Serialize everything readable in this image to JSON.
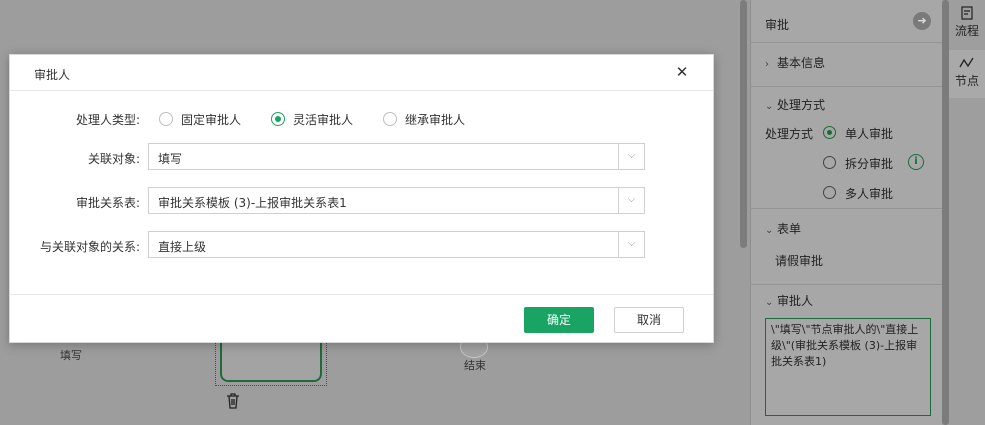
{
  "canvas": {
    "node_fill_label": "填写",
    "node_end_label": "结束",
    "trash_icon": "trash-icon"
  },
  "panel": {
    "title": "审批",
    "arrow_icon": "arrow-right-circle-icon",
    "basic_info": "基本信息",
    "processing_section": "处理方式",
    "processing_label": "处理方式",
    "processing_options": [
      "单人审批",
      "拆分审批",
      "多人审批"
    ],
    "processing_selected": "单人审批",
    "form_section": "表单",
    "form_value": "请假审批",
    "approver_section": "审批人",
    "approver_value": "\\\"填写\\\"节点审批人的\\\"直接上级\\\"(审批关系模板 (3)-上报审批关系表1)"
  },
  "side_tabs": [
    {
      "label": "流程",
      "icon": "flow-icon"
    },
    {
      "label": "节点",
      "icon": "node-icon"
    }
  ],
  "modal": {
    "title": "审批人",
    "close_icon": "close-icon",
    "handler_type_label": "处理人类型:",
    "handler_type_options": [
      "固定审批人",
      "灵活审批人",
      "继承审批人"
    ],
    "handler_type_selected": "灵活审批人",
    "related_object_label": "关联对象:",
    "related_object_value": "填写",
    "relation_table_label": "审批关系表:",
    "relation_table_value": "审批关系模板 (3)-上报审批关系表1",
    "relation_label": "与关联对象的关系:",
    "relation_value": "直接上级",
    "ok_label": "确定",
    "cancel_label": "取消"
  },
  "colors": {
    "accent": "#1aa464",
    "overlay": "#9b9b9b"
  }
}
